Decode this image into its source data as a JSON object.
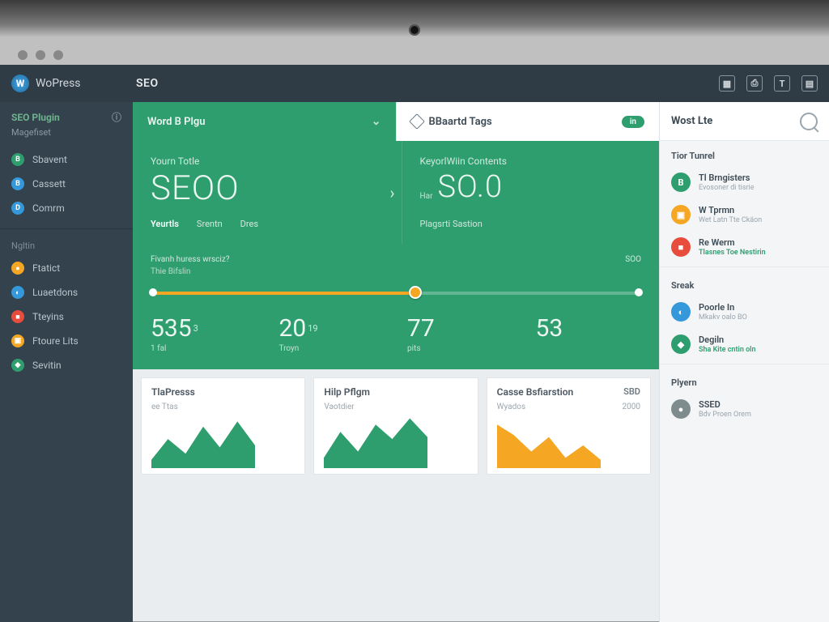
{
  "brand": {
    "logo_letter": "W",
    "name": "WoPress"
  },
  "topbar": {
    "title": "SEO",
    "tools": [
      "▦",
      "⎙",
      "T",
      "▤"
    ]
  },
  "sidebar": {
    "plugin_label": "SEO Plugin",
    "plugin_sub": "Magefiset",
    "group1": [
      {
        "label": "Sbavent",
        "color": "#2f9e6f"
      },
      {
        "label": "Cassett",
        "color": "#3498db"
      },
      {
        "label": "Comrm",
        "color": "#3498db"
      }
    ],
    "section2_title": "Ngltin",
    "group2": [
      {
        "label": "Ftatict",
        "color": "#f5a623"
      },
      {
        "label": "Luaetdons",
        "color": "#3498db"
      },
      {
        "label": "Tteyins",
        "color": "#e74c3c"
      },
      {
        "label": "Ftoure Lits",
        "color": "#f5a623"
      },
      {
        "label": "Sevitin",
        "color": "#2f9e6f"
      }
    ]
  },
  "tabs": {
    "active": {
      "label": "Word B Plgu"
    },
    "inactive": {
      "label": "BBaartd Tags",
      "pill": "in"
    }
  },
  "hero": {
    "left": {
      "label": "Yourn Totle",
      "big": "SEOO",
      "subtabs": [
        "Yeurtls",
        "Srentn",
        "Dres"
      ]
    },
    "right": {
      "label": "KeyorlWiin Contents",
      "little": "Har",
      "big": "SO.0",
      "sub": "Plagsrti Sastion"
    }
  },
  "slider": {
    "title": "Fivanh huress wrsciz?",
    "sub": "Thie Bifslin",
    "end_label": "SOO",
    "value_pct": 54
  },
  "stats": [
    {
      "num": "535",
      "sup": "3",
      "lab": "1 fal"
    },
    {
      "num": "20",
      "sup": "19",
      "lab": "Troyn"
    },
    {
      "num": "77",
      "sup": "",
      "lab": "pits"
    },
    {
      "num": "53",
      "sup": "",
      "lab": ""
    }
  ],
  "cards": [
    {
      "title": "TlaPresss",
      "sub": "ee Ttas"
    },
    {
      "title": "Hilp Pflgm",
      "sub": "Vaotdier"
    },
    {
      "title": "Casse Bsfiarstion",
      "right": "SBD",
      "sub": "Wyados",
      "y": "2000"
    }
  ],
  "rail": {
    "head": "Wost Lte",
    "section1": "Tior Tunrel",
    "items1": [
      {
        "title": "Tl Brngisters",
        "sub": "Evosoner di tisrie",
        "color": "#2f9e6f"
      },
      {
        "title": "W Tprmn",
        "sub": "Wet Latn Tte Ckäon",
        "color": "#f5a623"
      },
      {
        "title": "Re Werm",
        "sub": "Tlasnes Toe Nestirin",
        "color": "#e74c3c",
        "green": true
      }
    ],
    "section2": "Sreak",
    "items2": [
      {
        "title": "Poorle In",
        "sub": "Mkakv oalo BO",
        "color": "#3498db"
      },
      {
        "title": "Degiln",
        "sub": "Sha Kite cntin oln",
        "color": "#2f9e6f",
        "green": true
      }
    ],
    "section3": "Plyern",
    "items3": [
      {
        "title": "SSED",
        "sub": "Bdv Proen Orem",
        "color": "#7f8c8d"
      }
    ]
  },
  "chart_data": [
    {
      "type": "area",
      "title": "TlaPresss",
      "x": [
        0,
        1,
        2,
        3,
        4,
        5,
        6
      ],
      "values": [
        10,
        35,
        20,
        60,
        30,
        70,
        40
      ],
      "color": "#2f9e6f"
    },
    {
      "type": "area",
      "title": "Hilp Pflgm",
      "x": [
        0,
        1,
        2,
        3,
        4,
        5,
        6
      ],
      "values": [
        15,
        50,
        25,
        65,
        45,
        80,
        55
      ],
      "color": "#2f9e6f"
    },
    {
      "type": "area",
      "title": "Casse Bsfiarstion",
      "x": [
        0,
        1,
        2,
        3,
        4,
        5,
        6
      ],
      "values": [
        70,
        55,
        30,
        50,
        20,
        35,
        15
      ],
      "ylim": [
        0,
        2000
      ],
      "color": "#f5a623"
    }
  ]
}
